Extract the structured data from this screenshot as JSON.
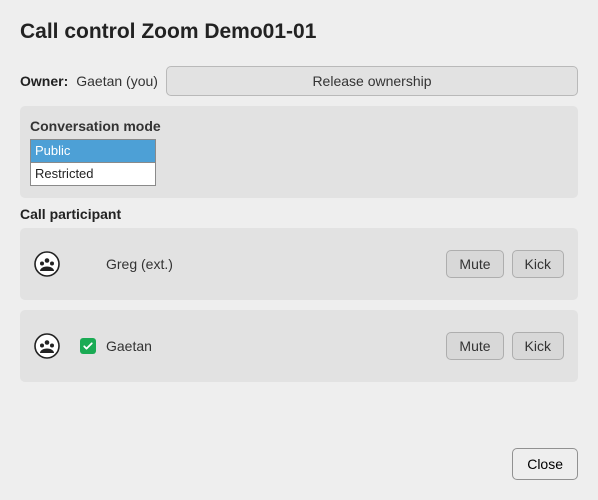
{
  "title": "Call control Zoom Demo01-01",
  "owner": {
    "label": "Owner:",
    "value": "Gaetan (you)",
    "release_label": "Release ownership"
  },
  "conversation_mode": {
    "title": "Conversation mode",
    "options": [
      {
        "label": "Public",
        "selected": true
      },
      {
        "label": "Restricted",
        "selected": false
      }
    ]
  },
  "participants_title": "Call participant",
  "participants": [
    {
      "name": "Greg (ext.)",
      "checked": false,
      "show_checkbox": false
    },
    {
      "name": "Gaetan",
      "checked": true,
      "show_checkbox": true
    }
  ],
  "buttons": {
    "mute": "Mute",
    "kick": "Kick",
    "close": "Close"
  },
  "icons": {
    "participant": "group-icon",
    "check": "check-icon"
  }
}
